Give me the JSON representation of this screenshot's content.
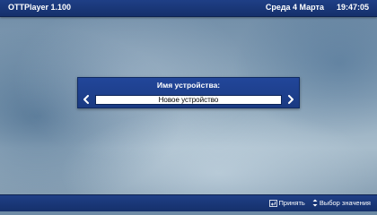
{
  "header": {
    "app_title": "OTTPlayer 1.100",
    "date": "Среда 4 Марта",
    "time": "19:47:05"
  },
  "dialog": {
    "title": "Имя устройства:",
    "value": "Новое устройство",
    "prev_icon": "chevron-left-icon",
    "next_icon": "chevron-right-icon"
  },
  "footer": {
    "hints": [
      {
        "icon": "enter-key-icon",
        "label": "Принять"
      },
      {
        "icon": "up-down-arrows-icon",
        "label": "Выбор значения"
      }
    ]
  },
  "colors": {
    "bar_blue": "#1f3f86",
    "dialog_blue": "#22469a",
    "text_white": "#ffffff",
    "field_bg": "#ffffff"
  }
}
